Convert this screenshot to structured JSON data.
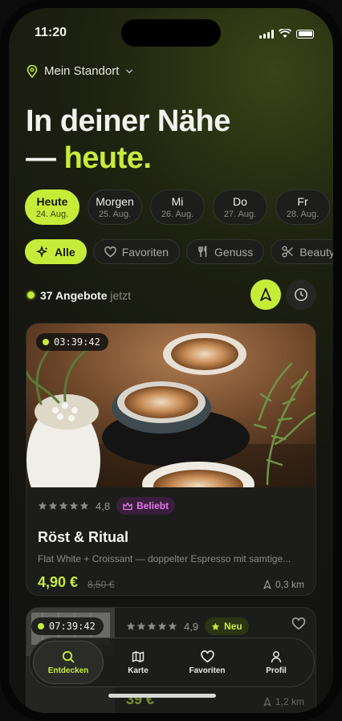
{
  "status": {
    "time": "11:20"
  },
  "location": {
    "label": "Mein Standort"
  },
  "headline": {
    "line1": "In deiner Nähe",
    "dash": "— ",
    "line2": "heute."
  },
  "days": [
    {
      "name": "Heute",
      "date": "24. Aug."
    },
    {
      "name": "Morgen",
      "date": "25. Aug."
    },
    {
      "name": "Mi",
      "date": "26. Aug."
    },
    {
      "name": "Do",
      "date": "27. Aug."
    },
    {
      "name": "Fr",
      "date": "28. Aug."
    }
  ],
  "categories": [
    {
      "label": "Alle",
      "icon": "sparkle-icon"
    },
    {
      "label": "Favoriten",
      "icon": "heart-icon"
    },
    {
      "label": "Genuss",
      "icon": "cutlery-icon"
    },
    {
      "label": "Beauty",
      "icon": "scissors-icon"
    }
  ],
  "offers": {
    "count": "37 Angebote",
    "suffix": "jetzt"
  },
  "card1": {
    "timer": "03:39:42",
    "rating": "4,8",
    "stars": 5,
    "badge": "Beliebt",
    "title": "Röst & Ritual",
    "description": "Flat White + Croissant — doppelter Espresso mit samtige...",
    "price": "4,90 €",
    "old_price": "8,50 €",
    "distance": "0,3 km"
  },
  "card2": {
    "timer": "07:39:42",
    "rating": "4,9",
    "stars": 5,
    "badge": "Neu",
    "price": "39 €",
    "distance": "1,2 km"
  },
  "tabs": [
    {
      "label": "Entdecken",
      "icon": "search-icon"
    },
    {
      "label": "Karte",
      "icon": "map-icon"
    },
    {
      "label": "Favoriten",
      "icon": "heart-icon"
    },
    {
      "label": "Profil",
      "icon": "user-icon"
    }
  ],
  "colors": {
    "accent": "#c6ec3a",
    "background": "#141510",
    "card": "#1c1d1a",
    "popular": "#e07ae8"
  }
}
